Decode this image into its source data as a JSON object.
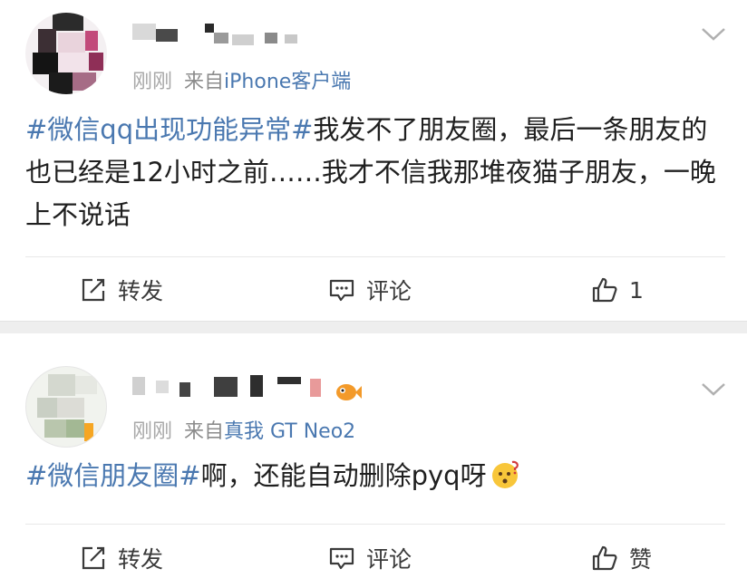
{
  "posts": [
    {
      "timestamp": "刚刚",
      "from_label": "来自",
      "source": "iPhone客户端",
      "topic": "#微信qq出现功能异常#",
      "text": "我发不了朋友圈，最后一条朋友的也已经是12小时之前……我才不信我那堆夜猫子朋友，一晚上不说话",
      "actions": {
        "repost": "转发",
        "comment": "评论",
        "like": "1"
      },
      "icons": {
        "avatar": "blurred-avatar",
        "expand": "chevron-down-icon",
        "repost": "repost-icon",
        "comment": "comment-icon",
        "like": "thumbs-up-icon"
      }
    },
    {
      "timestamp": "刚刚",
      "from_label": "来自",
      "source": "真我 GT Neo2",
      "topic": "#微信朋友圈#",
      "text": "啊，还能自动删除pyq呀",
      "actions": {
        "repost": "转发",
        "comment": "评论",
        "like": "赞"
      },
      "icons": {
        "avatar": "blurred-avatar",
        "expand": "chevron-down-icon",
        "badge": "fish-badge-icon",
        "emoji": "confused-face-emoji",
        "repost": "repost-icon",
        "comment": "comment-icon",
        "like": "thumbs-up-icon"
      }
    }
  ],
  "colors": {
    "link": "#4a78b0",
    "meta": "#8c8c8c",
    "separator": "#eeeeee",
    "text": "#1f1f1f"
  }
}
